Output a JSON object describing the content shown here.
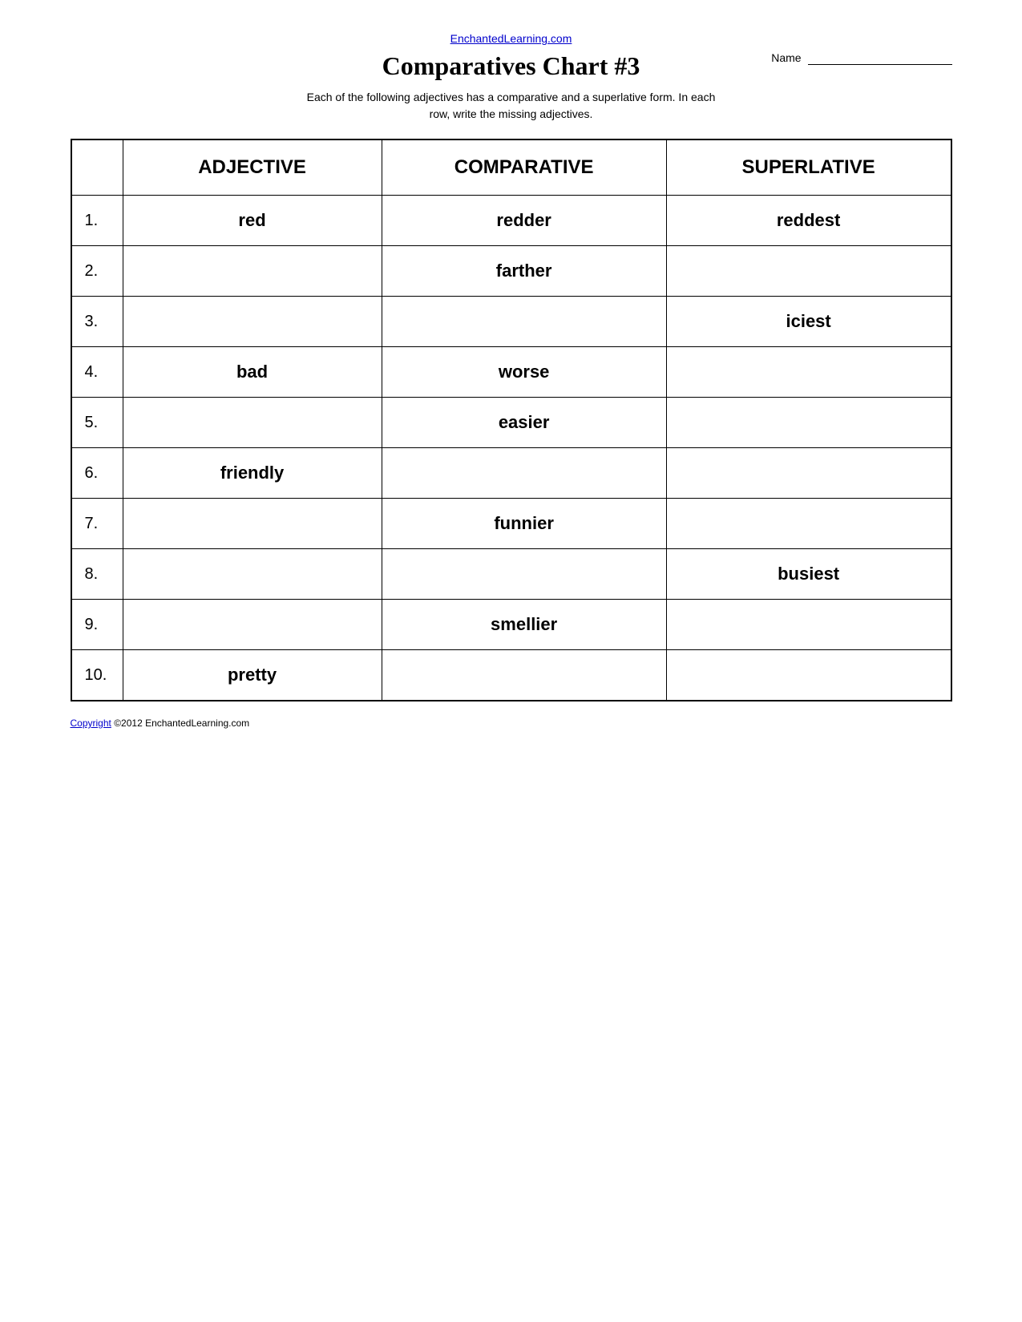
{
  "header": {
    "site_url_text": "EnchantedLearning.com",
    "title": "Comparatives Chart #3",
    "subtitle_line1": "Each of the following adjectives has a comparative and a superlative form. In each",
    "subtitle_line2": "row, write the missing adjectives.",
    "name_label": "Name"
  },
  "table": {
    "col_headers": [
      "",
      "ADJECTIVE",
      "COMPARATIVE",
      "SUPERLATIVE"
    ],
    "rows": [
      {
        "num": "1.",
        "adjective": "red",
        "comparative": "redder",
        "superlative": "reddest"
      },
      {
        "num": "2.",
        "adjective": "",
        "comparative": "farther",
        "superlative": ""
      },
      {
        "num": "3.",
        "adjective": "",
        "comparative": "",
        "superlative": "iciest"
      },
      {
        "num": "4.",
        "adjective": "bad",
        "comparative": "worse",
        "superlative": ""
      },
      {
        "num": "5.",
        "adjective": "",
        "comparative": "easier",
        "superlative": ""
      },
      {
        "num": "6.",
        "adjective": "friendly",
        "comparative": "",
        "superlative": ""
      },
      {
        "num": "7.",
        "adjective": "",
        "comparative": "funnier",
        "superlative": ""
      },
      {
        "num": "8.",
        "adjective": "",
        "comparative": "",
        "superlative": "busiest"
      },
      {
        "num": "9.",
        "adjective": "",
        "comparative": "smellier",
        "superlative": ""
      },
      {
        "num": "10.",
        "adjective": "pretty",
        "comparative": "",
        "superlative": ""
      }
    ]
  },
  "footer": {
    "copyright_text": "Copyright",
    "year_and_site": " ©2012 EnchantedLearning.com"
  }
}
